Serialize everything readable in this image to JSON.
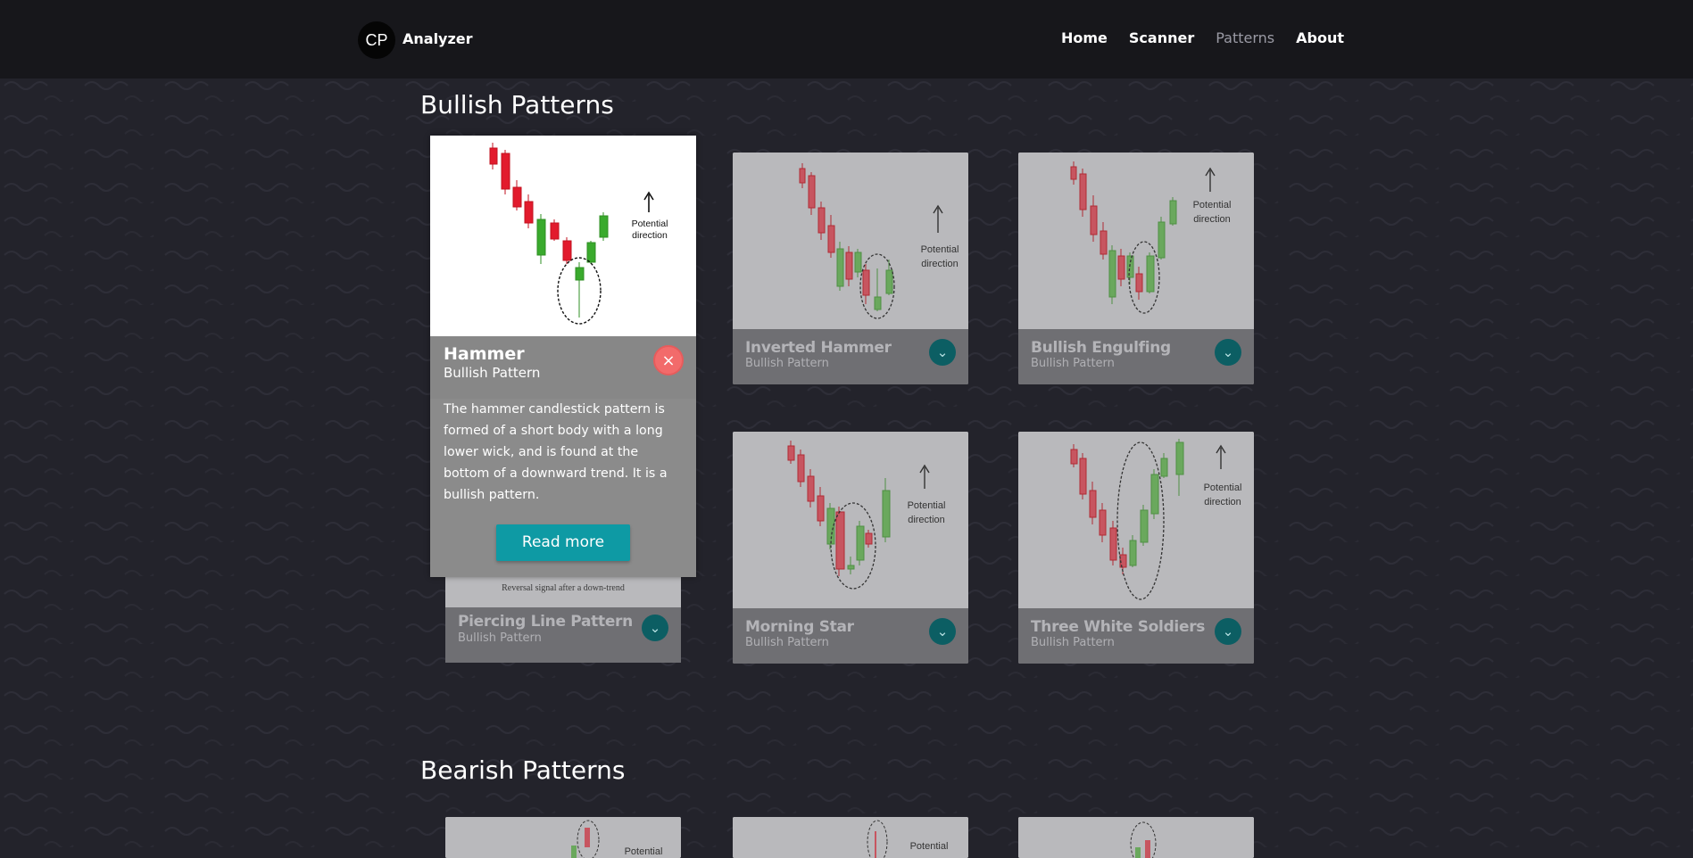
{
  "nav": {
    "logo_text": "CP",
    "brand": "Analyzer",
    "links": [
      {
        "label": "Home",
        "active": false
      },
      {
        "label": "Scanner",
        "active": false
      },
      {
        "label": "Patterns",
        "active": true
      },
      {
        "label": "About",
        "active": false
      }
    ]
  },
  "sections": {
    "bullish_title": "Bullish Patterns",
    "bearish_title": "Bearish Patterns"
  },
  "popup": {
    "name": "Hammer",
    "type": "Bullish Pattern",
    "description": "The hammer candlestick pattern is formed of a short body with a long lower wick, and is found at the bottom of a downward trend. It is a bullish pattern.",
    "read_more": "Read more",
    "close_icon": "×",
    "annotation": [
      "Potential",
      "direction"
    ]
  },
  "cards": [
    {
      "name": "Inverted Hammer",
      "type": "Bullish Pattern"
    },
    {
      "name": "Bullish Engulfing",
      "type": "Bullish Pattern"
    },
    {
      "name": "Piercing Line Pattern",
      "type": "Bullish Pattern",
      "caption": "Reversal signal after a down-trend"
    },
    {
      "name": "Morning Star",
      "type": "Bullish Pattern"
    },
    {
      "name": "Three White Soldiers",
      "type": "Bullish Pattern"
    }
  ],
  "bearish_cards": [
    {
      "annotation": "Potential"
    },
    {
      "annotation": "Potential"
    },
    {
      "annotation": ""
    }
  ],
  "icons": {
    "expand": "chevron-down-icon",
    "close": "close-icon"
  },
  "colors": {
    "background": "#23232b",
    "nav": "#17171b",
    "accent": "#0e9aa4",
    "close": "#f26b6b",
    "candle_red": "#d9182a",
    "candle_green": "#3a9d2f"
  }
}
